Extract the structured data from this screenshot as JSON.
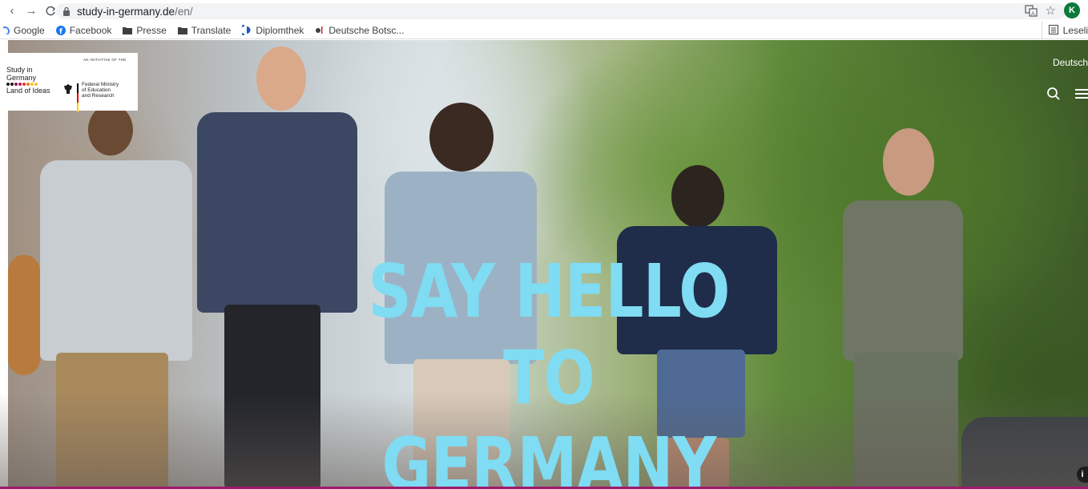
{
  "browser": {
    "url_host": "study-in-germany.de",
    "url_path": "/en/",
    "profile_initial": "K",
    "bookmarks": [
      {
        "label": "Google",
        "icon": "google-icon"
      },
      {
        "label": "Facebook",
        "icon": "facebook-icon"
      },
      {
        "label": "Presse",
        "icon": "folder-icon"
      },
      {
        "label": "Translate",
        "icon": "folder-icon"
      },
      {
        "label": "Diplomthek",
        "icon": "diplomthek-icon"
      },
      {
        "label": "Deutsche Botsc...",
        "icon": "embassy-icon"
      }
    ],
    "reading_list": "Leseli"
  },
  "site": {
    "logo": {
      "line1": "Study in",
      "line2": "Germany",
      "line3": "Land of Ideas",
      "initiative": "AN INITIATIVE OF THE",
      "ministry_line1": "Federal Ministry",
      "ministry_line2": "of Education",
      "ministry_line3": "and Research"
    },
    "language_link": "Deutsch",
    "headline_line1": "SAY HELLO TO",
    "headline_line2": "GERMANY",
    "info_button": "i"
  },
  "colors": {
    "headline": "#7fdcf2",
    "accent_bar": "#a0196b",
    "profile": "#0b7a3b"
  }
}
